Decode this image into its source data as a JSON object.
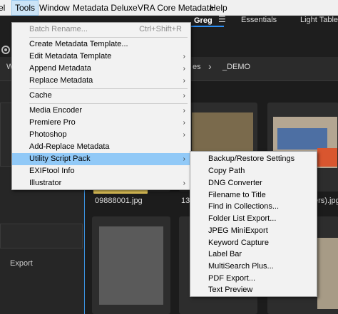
{
  "menubar": {
    "items": [
      "el",
      "Tools",
      "Window",
      "Metadata Deluxe",
      "VRA Core Metadata",
      "Help"
    ]
  },
  "workspaces": {
    "greg": "Greg",
    "greg_menu_icon": "menu-lines-icon",
    "essentials": "Essentials",
    "light_table": "Light Table"
  },
  "pathbar": {
    "left_fragment": "W",
    "crumb_partial": "es",
    "current": "_DEMO"
  },
  "left_panel": {
    "export_label": "Export"
  },
  "content": {
    "filenames": [
      "09888001.jpg",
      "138",
      "ers).jpg"
    ]
  },
  "tools_menu": {
    "items": [
      {
        "label": "Batch Rename...",
        "shortcut": "Ctrl+Shift+R",
        "disabled": true
      },
      {
        "label": "Create Metadata Template..."
      },
      {
        "label": "Edit Metadata Template",
        "submenu": true
      },
      {
        "label": "Append Metadata",
        "submenu": true
      },
      {
        "label": "Replace Metadata",
        "submenu": true
      },
      {
        "label": "Cache",
        "submenu": true
      },
      {
        "label": "Media Encoder",
        "submenu": true
      },
      {
        "label": "Premiere Pro",
        "submenu": true
      },
      {
        "label": "Photoshop",
        "submenu": true
      },
      {
        "label": "Add-Replace Metadata"
      },
      {
        "label": "Utility Script Pack",
        "submenu": true,
        "highlight": true
      },
      {
        "label": "EXIFtool Info"
      },
      {
        "label": "Illustrator",
        "submenu": true
      }
    ]
  },
  "utility_submenu": {
    "items": [
      "Backup/Restore Settings",
      "Copy Path",
      "DNG Converter",
      "Filename to Title",
      "Find in Collections...",
      "Folder List Export...",
      "JPEG MiniExport",
      "Keyword Capture",
      "Label Bar",
      "MultiSearch Plus...",
      "PDF Export...",
      "Text Preview"
    ]
  },
  "colors": {
    "highlight": "#91c9f7",
    "accent_blue": "#2b8ef5",
    "label_yellow": "#e8c95a"
  }
}
